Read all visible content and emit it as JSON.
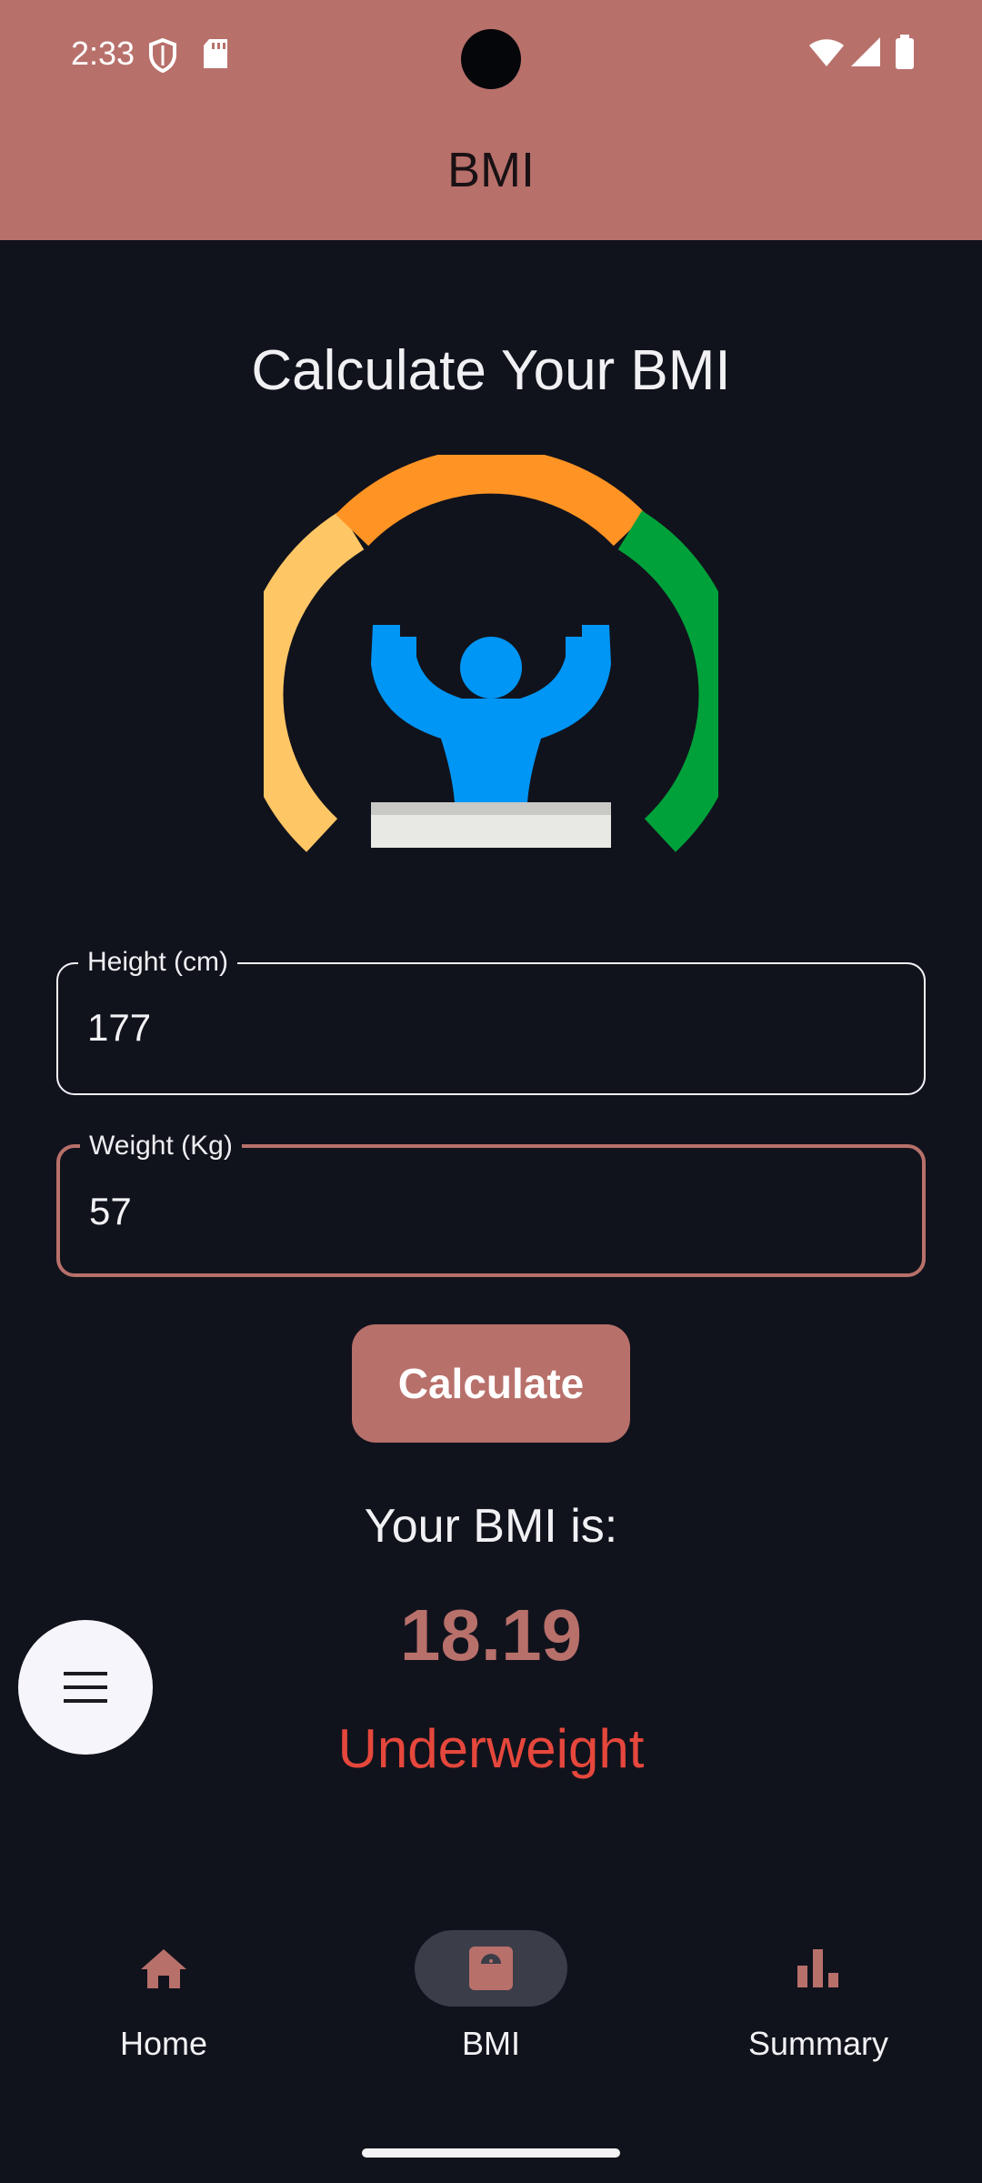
{
  "status_bar": {
    "time": "2:33",
    "icons": [
      "shield-icon",
      "sd-card-icon",
      "wifi-icon",
      "cellular-signal-icon",
      "battery-icon"
    ]
  },
  "app_bar": {
    "title": "BMI",
    "background_color": "#b8706b"
  },
  "main": {
    "heading": "Calculate Your BMI",
    "illustration": "bmi-gauge-strongman-icon",
    "height_field": {
      "label": "Height (cm)",
      "value": "177"
    },
    "weight_field": {
      "label": "Weight (Kg)",
      "value": "57"
    },
    "calculate_button": "Calculate",
    "result": {
      "label": "Your BMI is:",
      "value": "18.19",
      "category": "Underweight",
      "category_color": "#e6473c"
    }
  },
  "fab": {
    "icon": "menu-icon"
  },
  "bottom_nav": {
    "items": [
      {
        "label": "Home",
        "icon": "home-icon",
        "active": false
      },
      {
        "label": "BMI",
        "icon": "scale-icon",
        "active": true
      },
      {
        "label": "Summary",
        "icon": "bar-chart-icon",
        "active": false
      }
    ]
  },
  "colors": {
    "accent": "#b8706b",
    "background": "#11131c"
  }
}
